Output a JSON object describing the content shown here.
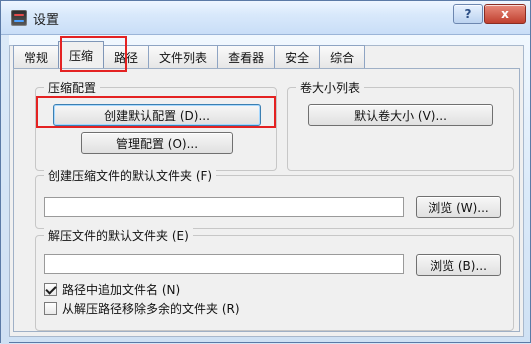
{
  "window": {
    "title": "设置",
    "help_label": "?",
    "close_label": "x"
  },
  "tabs": [
    {
      "label": "常规"
    },
    {
      "label": "压缩"
    },
    {
      "label": "路径"
    },
    {
      "label": "文件列表"
    },
    {
      "label": "查看器"
    },
    {
      "label": "安全"
    },
    {
      "label": "综合"
    }
  ],
  "compression_config": {
    "title": "压缩配置",
    "create_default_label": "创建默认配置 (D)...",
    "manage_label": "管理配置 (O)..."
  },
  "volume_size_list": {
    "title": "卷大小列表",
    "default_volume_label": "默认卷大小 (V)..."
  },
  "default_compress_folder": {
    "title": "创建压缩文件的默认文件夹 (F)",
    "value": "",
    "browse_label": "浏览 (W)..."
  },
  "extract_folder": {
    "title": "解压文件的默认文件夹 (E)",
    "value": "",
    "browse_label": "浏览 (B)...",
    "append_name_label": "路径中追加文件名 (N)",
    "append_name_checked": true,
    "remove_redundant_label": "从解压路径移除多余的文件夹 (R)",
    "remove_redundant_checked": false
  }
}
